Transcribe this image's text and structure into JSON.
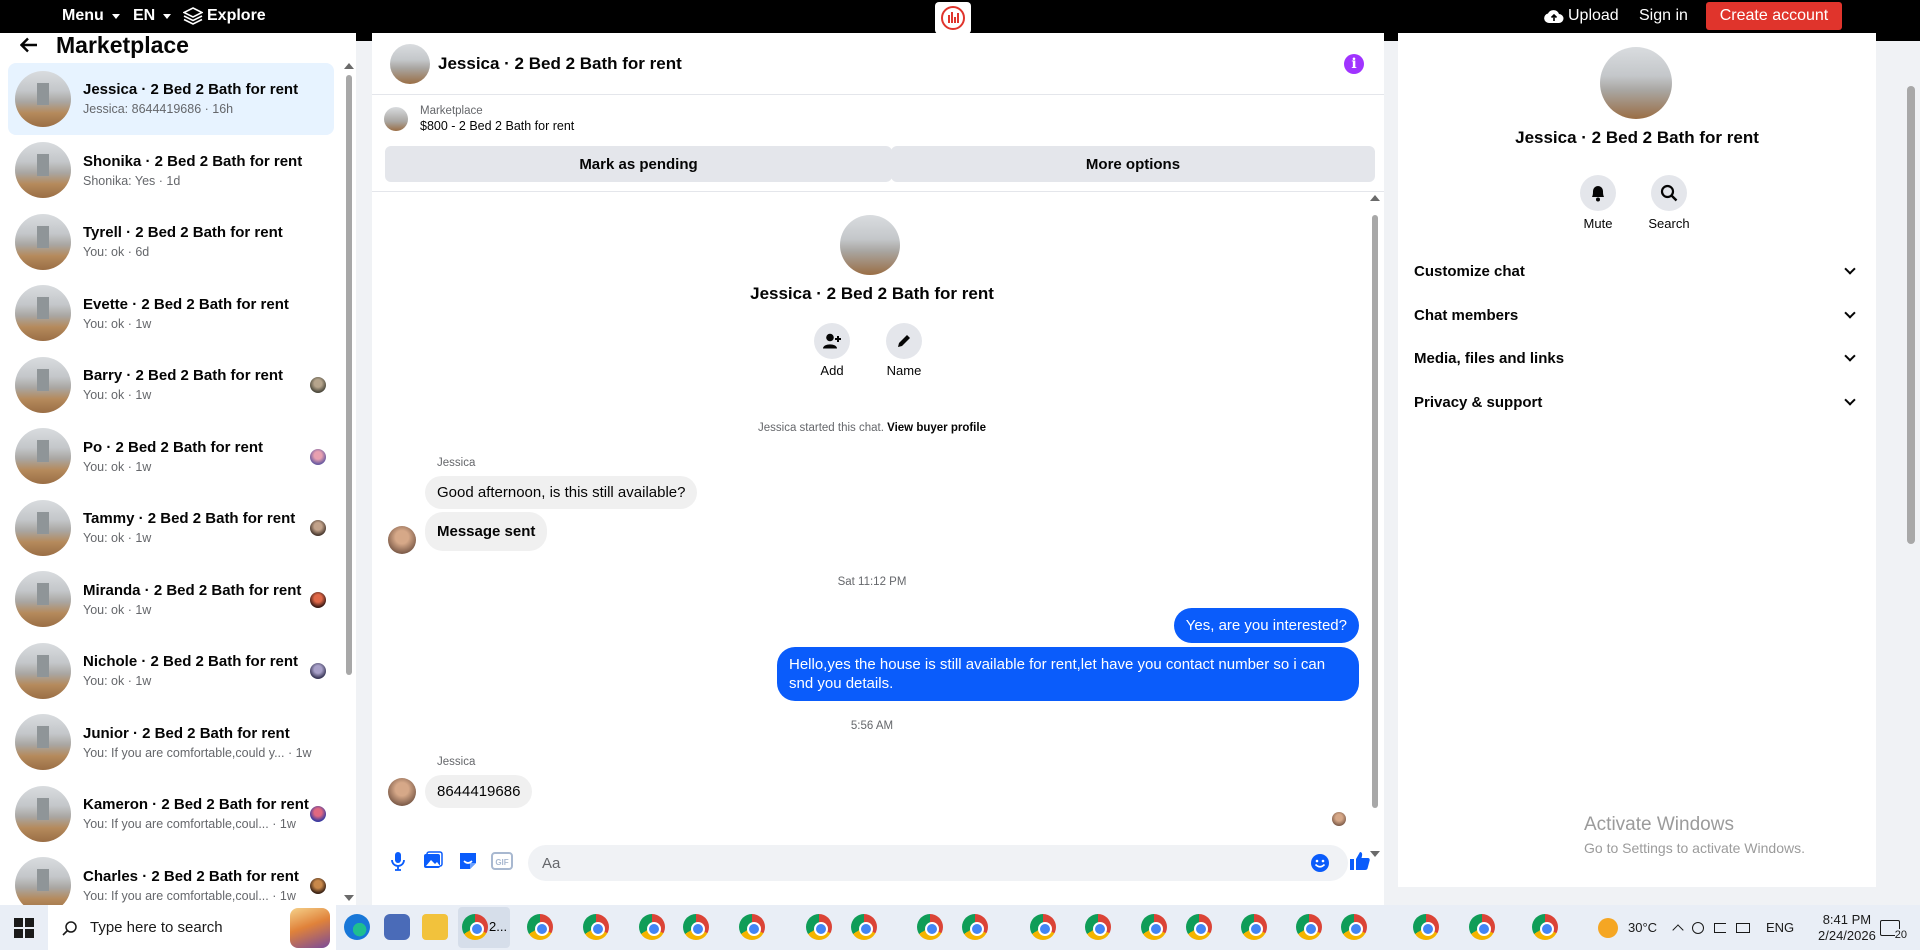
{
  "topbar": {
    "menu": "Menu",
    "lang": "EN",
    "explore": "Explore",
    "upload": "Upload",
    "signin": "Sign in",
    "create": "Create account"
  },
  "sidebar": {
    "title": "Marketplace",
    "conversations": [
      {
        "title": "Jessica · 2 Bed 2 Bath for rent",
        "sub": "Jessica: 8644419686 · 16h",
        "active": true
      },
      {
        "title": "Shonika · 2 Bed 2 Bath for rent",
        "sub": "Shonika: Yes · 1d"
      },
      {
        "title": "Tyrell · 2 Bed 2 Bath for rent",
        "sub": "You: ok · 6d"
      },
      {
        "title": "Evette · 2 Bed 2 Bath for rent",
        "sub": "You: ok · 1w"
      },
      {
        "title": "Barry · 2 Bed 2 Bath for rent",
        "sub": "You: ok · 1w",
        "seen": true
      },
      {
        "title": "Po · 2 Bed 2 Bath for rent",
        "sub": "You: ok · 1w",
        "seen": true
      },
      {
        "title": "Tammy · 2 Bed 2 Bath for rent",
        "sub": "You: ok · 1w",
        "seen": true
      },
      {
        "title": "Miranda · 2 Bed 2 Bath for rent",
        "sub": "You: ok · 1w",
        "seen": true
      },
      {
        "title": "Nichole · 2 Bed 2 Bath for rent",
        "sub": "You: ok · 1w",
        "seen": true
      },
      {
        "title": "Junior · 2 Bed 2 Bath for rent",
        "sub": "You: If you are comfortable,could y... · 1w"
      },
      {
        "title": "Kameron · 2 Bed 2 Bath for rent",
        "sub": "You: If you are comfortable,coul... · 1w",
        "seen": true
      },
      {
        "title": "Charles · 2 Bed 2 Bath for rent",
        "sub": "You: If you are comfortable,coul... · 1w",
        "seen": true
      }
    ]
  },
  "chat": {
    "header_name": "Jessica · 2 Bed 2 Bath for rent",
    "listing_label": "Marketplace",
    "listing_title": "$800 - 2 Bed 2 Bath for rent",
    "mark_pending": "Mark as pending",
    "more_options": "More options",
    "center_name": "Jessica · 2 Bed 2 Bath for rent",
    "add_label": "Add",
    "name_label": "Name",
    "started_text": "Jessica started this chat.",
    "view_profile": "View buyer profile",
    "sender1": "Jessica",
    "msg1": "Good afternoon, is this still available?",
    "msg2": "Message sent",
    "ts1": "Sat 11:12 PM",
    "out1": "Yes, are you interested?",
    "out2": "Hello,yes the house is still available for rent,let have you contact number so i can snd you details.",
    "ts2": "5:56 AM",
    "sender2": "Jessica",
    "msg3": "8644419686",
    "composer_placeholder": "Aa"
  },
  "rpanel": {
    "name": "Jessica · 2 Bed 2 Bath for rent",
    "mute": "Mute",
    "search": "Search",
    "sections": [
      "Customize chat",
      "Chat members",
      "Media, files and links",
      "Privacy & support"
    ],
    "watermark1": "Activate Windows",
    "watermark2": "Go to Settings to activate Windows."
  },
  "taskbar": {
    "search_placeholder": "Type here to search",
    "active_app_label": "2...",
    "weather": "30°C",
    "lang": "ENG",
    "time": "8:41 PM",
    "date": "2/24/2026",
    "notif_count": "20"
  },
  "colors": {
    "accent_blue": "#0a5cfb",
    "create_red": "#e0342c",
    "info_purple": "#a033ff"
  }
}
